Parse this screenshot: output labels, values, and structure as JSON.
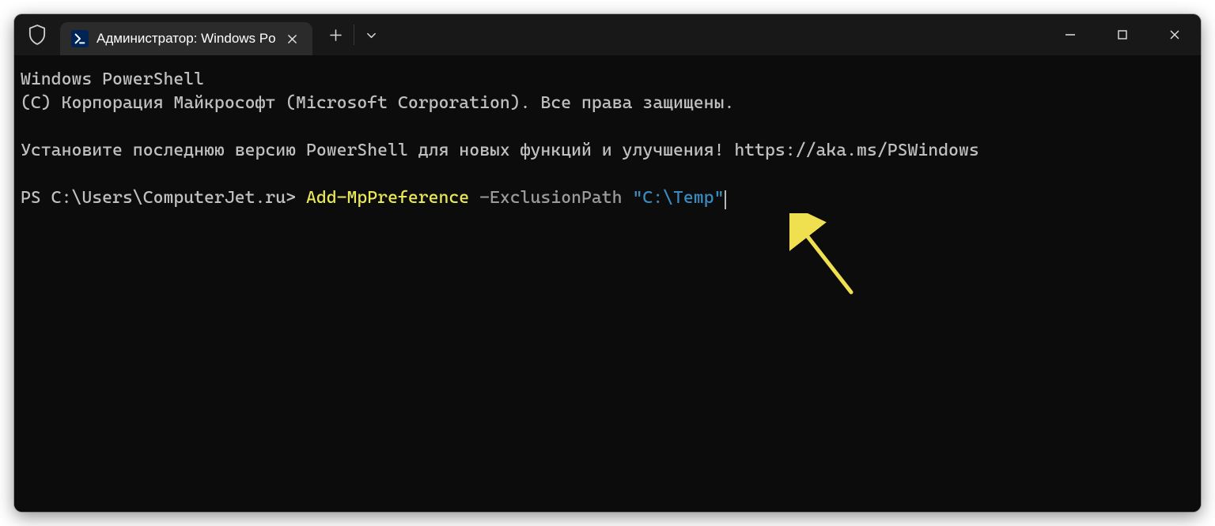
{
  "tab": {
    "title": "Администратор: Windows Po"
  },
  "terminal": {
    "banner_line1": "Windows PowerShell",
    "banner_line2": "(C) Корпорация Майкрософт (Microsoft Corporation). Все права защищены.",
    "update_msg": "Установите последнюю версию PowerShell для новых функций и улучшения! https://aka.ms/PSWindows",
    "prompt": "PS C:\\Users\\ComputerJet.ru> ",
    "cmdlet": "Add-MpPreference",
    "param_space": " ",
    "param_name": "-ExclusionPath",
    "arg_space": " ",
    "arg_value": "\"C:\\Temp\""
  }
}
